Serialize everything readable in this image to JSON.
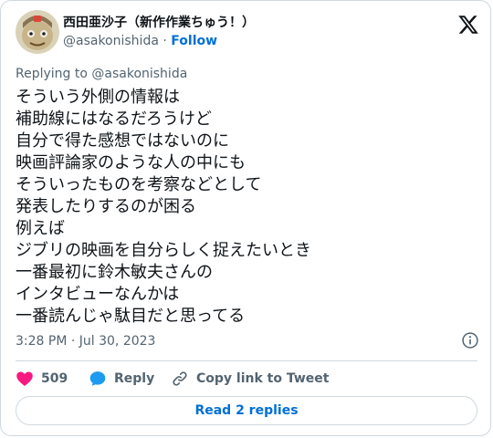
{
  "author": {
    "display_name": "西田亜沙子（新作作業ちゅう！）",
    "handle": "@asakonishida",
    "separator": " · ",
    "follow_label": "Follow"
  },
  "reply_to": "Replying to @asakonishida",
  "tweet": {
    "lines": [
      "そういう外側の情報は",
      "補助線にはなるだろうけど",
      "自分で得た感想ではないのに",
      "映画評論家のような人の中にも",
      "そういったものを考察などとして",
      "発表したりするのが困る",
      "例えば",
      "ジブリの映画を自分らしく捉えたいとき",
      "一番最初に鈴木敏夫さんの",
      "インタビューなんかは",
      "一番読んじゃ駄目だと思ってる"
    ],
    "timestamp": "3:28 PM · Jul 30, 2023"
  },
  "actions": {
    "like_count": "509",
    "reply_label": "Reply",
    "copy_label": "Copy link to Tweet"
  },
  "replies_button": "Read 2 replies",
  "icons": {
    "logo": "x-logo-icon",
    "info": "info-icon",
    "like": "heart-icon",
    "reply": "speech-bubble-icon",
    "copy": "link-icon"
  },
  "colors": {
    "like": "#f91880",
    "reply": "#1d9bf0",
    "link": "#006fd6",
    "muted": "#536471",
    "border": "#cfd9de"
  }
}
